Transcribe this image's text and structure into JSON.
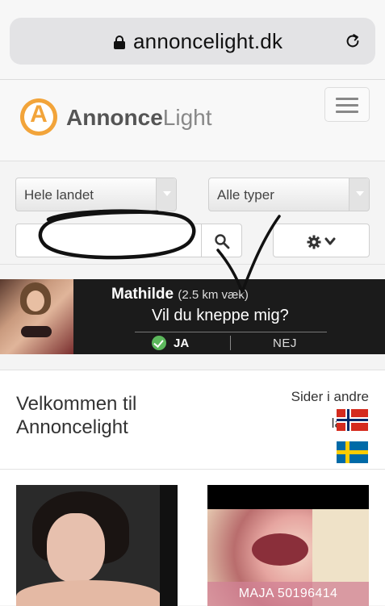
{
  "browser": {
    "url": "annoncelight.dk"
  },
  "header": {
    "logo_letter": "A",
    "brand_bold": "Annonce",
    "brand_light": "Light"
  },
  "filters": {
    "region_select": "Hele landet",
    "type_select": "Alle typer",
    "search_value": ""
  },
  "ad": {
    "name": "Mathilde",
    "distance": "(2.5 km væk)",
    "question": "Vil du kneppe mig?",
    "yes_label": "JA",
    "no_label": "NEJ"
  },
  "welcome": {
    "title": "Velkommen til Annoncelight",
    "other_countries": "Sider i andre lande:"
  },
  "listings": [
    {
      "caption": ""
    },
    {
      "caption": "MAJA 50196414"
    }
  ],
  "colors": {
    "logo_orange": "#f2a43a",
    "ad_background": "#1b1b1b",
    "yes_green": "#5cb85c"
  }
}
